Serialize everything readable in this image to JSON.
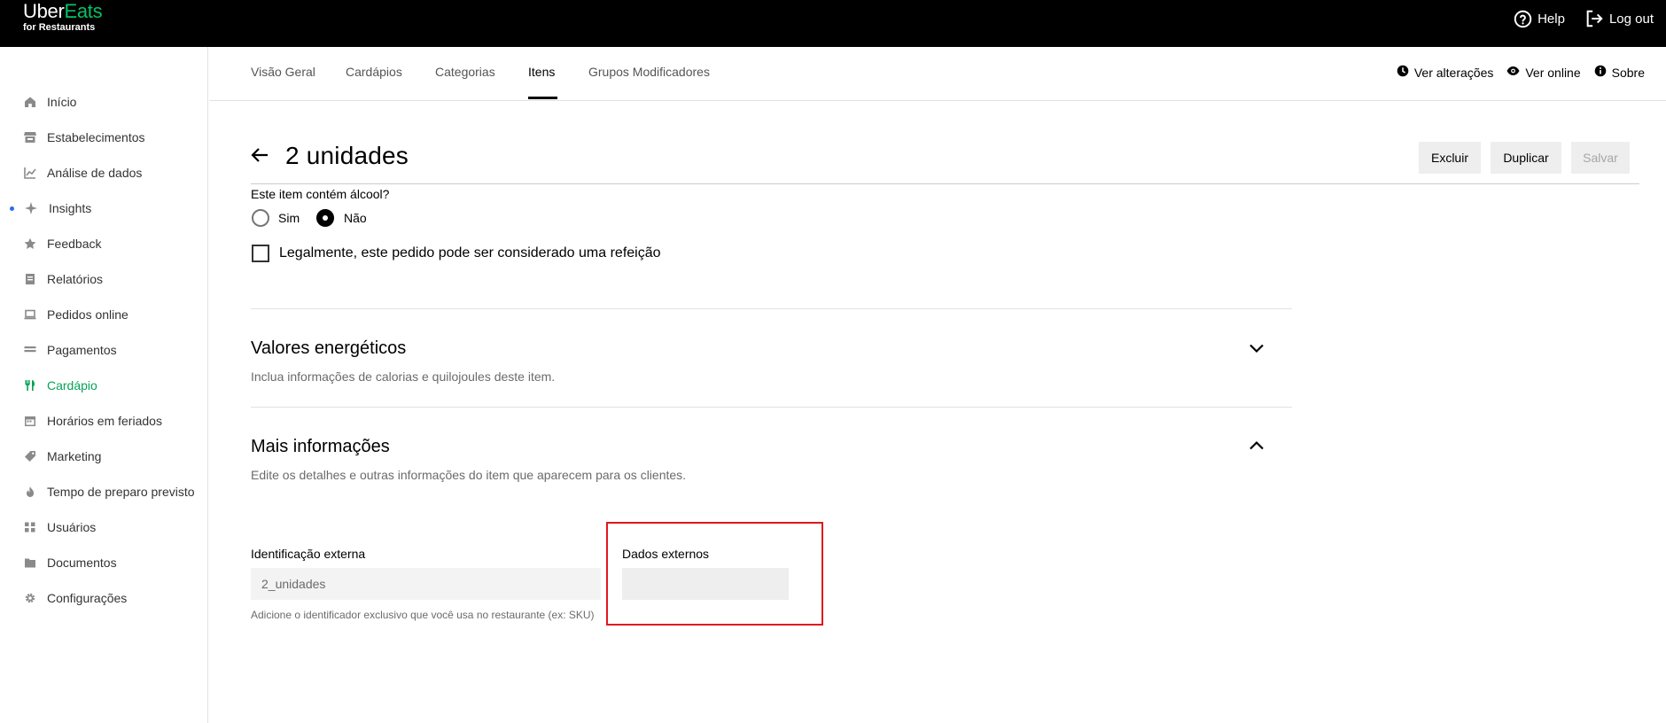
{
  "topbar": {
    "logo_line1_part1": "Uber",
    "logo_line1_part2": "Eats",
    "logo_line2": "for Restaurants",
    "help_label": "Help",
    "logout_label": "Log out"
  },
  "sidebar": {
    "items": [
      {
        "label": "Início",
        "icon": "home-icon"
      },
      {
        "label": "Estabelecimentos",
        "icon": "store-icon"
      },
      {
        "label": "Análise de dados",
        "icon": "chart-icon"
      },
      {
        "label": "Insights",
        "icon": "sparkle-icon"
      },
      {
        "label": "Feedback",
        "icon": "star-icon"
      },
      {
        "label": "Relatórios",
        "icon": "report-icon"
      },
      {
        "label": "Pedidos online",
        "icon": "laptop-icon"
      },
      {
        "label": "Pagamentos",
        "icon": "payment-icon"
      },
      {
        "label": "Cardápio",
        "icon": "fork-knife-icon"
      },
      {
        "label": "Horários em feriados",
        "icon": "calendar-icon"
      },
      {
        "label": "Marketing",
        "icon": "tag-icon"
      },
      {
        "label": "Tempo de preparo previsto",
        "icon": "flame-icon"
      },
      {
        "label": "Usuários",
        "icon": "users-icon"
      },
      {
        "label": "Documentos",
        "icon": "folder-icon"
      },
      {
        "label": "Configurações",
        "icon": "gear-icon"
      }
    ]
  },
  "tabs": {
    "items": [
      "Visão Geral",
      "Cardápios",
      "Categorias",
      "Itens",
      "Grupos Modificadores"
    ],
    "ver_alteracoes": "Ver alterações",
    "ver_online": "Ver online",
    "sobre": "Sobre"
  },
  "header": {
    "title": "2 unidades",
    "delete_label": "Excluir",
    "duplicate_label": "Duplicar",
    "save_label": "Salvar"
  },
  "alcohol": {
    "question": "Este item contém álcool?",
    "yes_label": "Sim",
    "no_label": "Não",
    "meal_checkbox_label": "Legalmente, este pedido pode ser considerado uma refeição"
  },
  "energy": {
    "title": "Valores energéticos",
    "subtitle": "Inclua informações de calorias e quilojoules deste item."
  },
  "more_info": {
    "title": "Mais informações",
    "subtitle": "Edite os detalhes e outras informações do item que aparecem para os clientes.",
    "external_id_label": "Identificação externa",
    "external_id_value": "2_unidades",
    "external_id_hint": "Adicione o identificador exclusivo que você usa no restaurante (ex: SKU)",
    "external_data_label": "Dados externos",
    "external_data_value": ""
  },
  "colors": {
    "brand_green": "#06c167",
    "active_green": "#05a357",
    "highlight_red": "#e0181e",
    "insight_dot": "#276ef1"
  }
}
